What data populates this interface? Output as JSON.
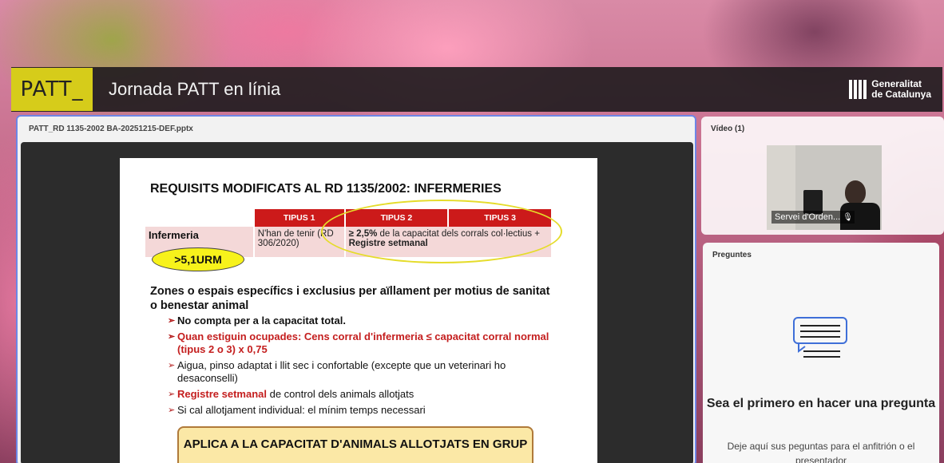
{
  "header": {
    "logo_text": "PATT_",
    "title": "Jornada PATT en línia",
    "org_line1": "Generalitat",
    "org_line2": "de Catalunya"
  },
  "share_pod": {
    "file_name": "PATT_RD 1135-2002 BA-20251215-DEF.pptx"
  },
  "slide": {
    "title": "REQUISITS MODIFICATS AL RD 1135/2002: INFERMERIES",
    "table": {
      "headers": [
        "",
        "TIPUS 1",
        "TIPUS 2",
        "TIPUS 3"
      ],
      "row_label": "Infermeria",
      "tipus1": "N'han de tenir (RD 306/2020)",
      "tipus23_bold_prefix": "≥ 2,5%",
      "tipus23_text": " de la capacitat dels corrals col·lectius + ",
      "tipus23_bold_suffix": "Registre setmanal"
    },
    "urm_badge": ">5,1URM",
    "zones_heading": "Zones o espais específics i exclusius per aïllament per motius de sanitat o benestar animal",
    "bullets": {
      "b1": "No compta per a la capacitat total.",
      "b2": "Quan estiguin ocupades: Cens corral d'infermeria ≤ capacitat corral normal (tipus 2 o 3) x 0,75",
      "b3": "Aigua, pinso adaptat i llit sec i confortable (excepte que un veterinari ho desaconselli)",
      "b4_red": "Registre setmanal",
      "b4_rest": " de control dels animals allotjats",
      "b5": "Si cal allotjament individual: el mínim temps necessari"
    },
    "box_text": "APLICA A LA CAPACITAT D'ANIMALS ALLOTJATS EN GRUP"
  },
  "video_pod": {
    "label": "Vídeo (1)",
    "participant_name": "Servei d'Orden..."
  },
  "questions_pod": {
    "label": "Preguntes",
    "heading": "Sea el primero en hacer una pregunta",
    "subtext": "Deje aquí sus peguntas para el anfitrión o el presentador"
  },
  "colors": {
    "logo_bg": "#d6cc1a",
    "table_header_red": "#cc1a1a",
    "highlight_yellow": "#f7f21b",
    "pod_border_blue": "#6d86e6"
  }
}
